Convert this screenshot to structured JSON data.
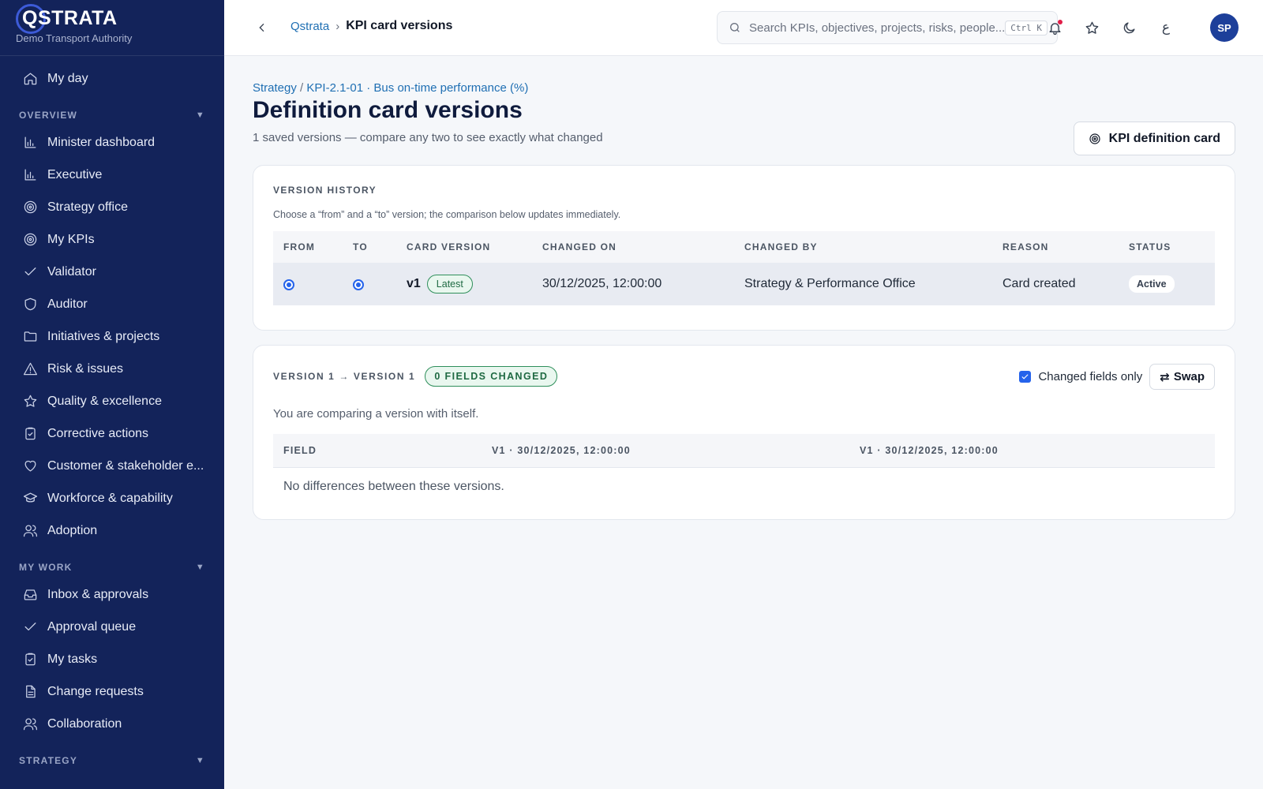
{
  "brand": {
    "logo": "QSTRATA",
    "org": "Demo Transport Authority"
  },
  "sidebar": {
    "top_items": [
      {
        "label": "My day",
        "icon": "home-icon"
      }
    ],
    "sections": [
      {
        "title": "OVERVIEW",
        "items": [
          {
            "label": "Minister dashboard",
            "icon": "bar-chart-icon"
          },
          {
            "label": "Executive",
            "icon": "bar-chart-icon"
          },
          {
            "label": "Strategy office",
            "icon": "target-icon"
          },
          {
            "label": "My KPIs",
            "icon": "target-icon"
          },
          {
            "label": "Validator",
            "icon": "check-icon"
          },
          {
            "label": "Auditor",
            "icon": "shield-icon"
          },
          {
            "label": "Initiatives & projects",
            "icon": "folder-icon"
          },
          {
            "label": "Risk & issues",
            "icon": "warning-icon"
          },
          {
            "label": "Quality & excellence",
            "icon": "star-icon"
          },
          {
            "label": "Corrective actions",
            "icon": "clipboard-check-icon"
          },
          {
            "label": "Customer & stakeholder e...",
            "icon": "heart-icon"
          },
          {
            "label": "Workforce & capability",
            "icon": "graduation-cap-icon"
          },
          {
            "label": "Adoption",
            "icon": "users-icon"
          }
        ]
      },
      {
        "title": "MY WORK",
        "items": [
          {
            "label": "Inbox & approvals",
            "icon": "inbox-icon"
          },
          {
            "label": "Approval queue",
            "icon": "check-icon"
          },
          {
            "label": "My tasks",
            "icon": "clipboard-check-icon"
          },
          {
            "label": "Change requests",
            "icon": "document-icon"
          },
          {
            "label": "Collaboration",
            "icon": "users-icon"
          }
        ]
      },
      {
        "title": "STRATEGY",
        "items": []
      }
    ]
  },
  "topbar": {
    "breadcrumb_root": "Qstrata",
    "breadcrumb_sep": "›",
    "breadcrumb_current": "KPI card versions",
    "search_placeholder": "Search KPIs, objectives, projects, risks, people...",
    "search_shortcut": "Ctrl K",
    "lang_toggle": "ع",
    "avatar_initials": "SP"
  },
  "page": {
    "crumb_parent": "Strategy",
    "crumb_sep": "/",
    "crumb_kpi": "KPI-2.1-01 · Bus on-time performance (%)",
    "title": "Definition card versions",
    "subtitle": "1 saved versions — compare any two to see exactly what changed",
    "def_button": "KPI definition card"
  },
  "history": {
    "heading": "VERSION HISTORY",
    "hint": "Choose a “from” and a “to” version; the comparison below updates immediately.",
    "columns": [
      "FROM",
      "TO",
      "CARD VERSION",
      "CHANGED ON",
      "CHANGED BY",
      "REASON",
      "STATUS"
    ],
    "rows": [
      {
        "version": "v1",
        "badge": "Latest",
        "changed_on": "30/12/2025, 12:00:00",
        "changed_by": "Strategy & Performance Office",
        "reason": "Card created",
        "status": "Active",
        "from_selected": true,
        "to_selected": true
      }
    ]
  },
  "compare": {
    "title": "VERSION 1 → VERSION 1",
    "badge": "0 FIELDS CHANGED",
    "changed_only_label": "Changed fields only",
    "changed_only_checked": true,
    "swap_label": "Swap",
    "note": "You are comparing a version with itself.",
    "columns": [
      "FIELD",
      "V1 · 30/12/2025, 12:00:00",
      "V1 · 30/12/2025, 12:00:00"
    ],
    "empty": "No differences between these versions."
  },
  "colors": {
    "sidebar_bg": "#13235a",
    "accent": "#2563eb",
    "link": "#1f6fb3",
    "success": "#2f8f5b"
  }
}
